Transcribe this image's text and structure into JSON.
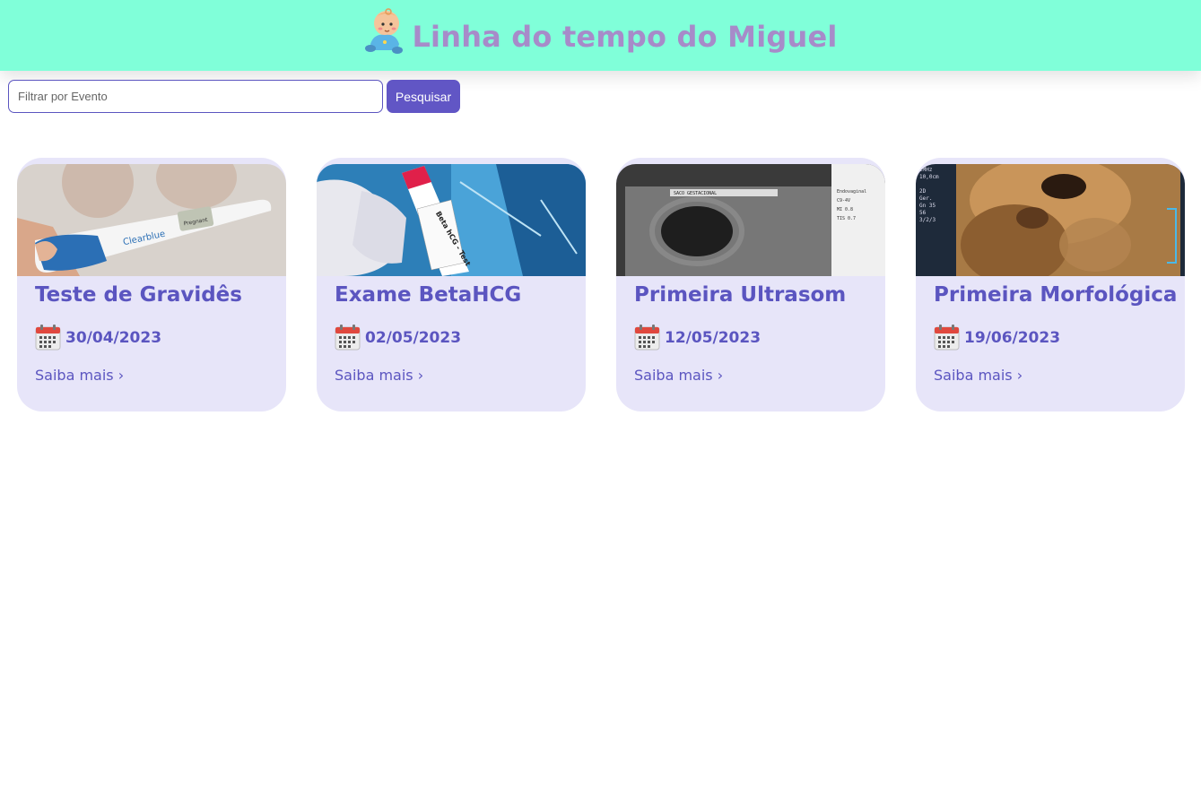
{
  "header": {
    "title": "Linha do tempo do Miguel",
    "icon": "baby-icon"
  },
  "search": {
    "placeholder": "Filtrar por Evento",
    "value": "",
    "button_label": "Pesquisar"
  },
  "colors": {
    "header_bg": "#80ffd9",
    "title": "#a78bc9",
    "accent": "#5b55c0",
    "card_bg": "#e7e5f9"
  },
  "cards": [
    {
      "title": "Teste de Gravidês",
      "date": "30/04/2023",
      "link": "Saiba mais",
      "chevron": "›",
      "image": "pregnancy-test-photo"
    },
    {
      "title": "Exame BetaHCG",
      "date": "02/05/2023",
      "link": "Saiba mais",
      "chevron": "›",
      "image": "beta-hcg-tube-photo"
    },
    {
      "title": "Primeira Ultrasom",
      "date": "12/05/2023",
      "link": "Saiba mais",
      "chevron": "›",
      "image": "ultrasound-photo"
    },
    {
      "title": "Primeira Morfológica",
      "date": "19/06/2023",
      "link": "Saiba mais",
      "chevron": "›",
      "image": "morphology-ultrasound-photo"
    }
  ]
}
